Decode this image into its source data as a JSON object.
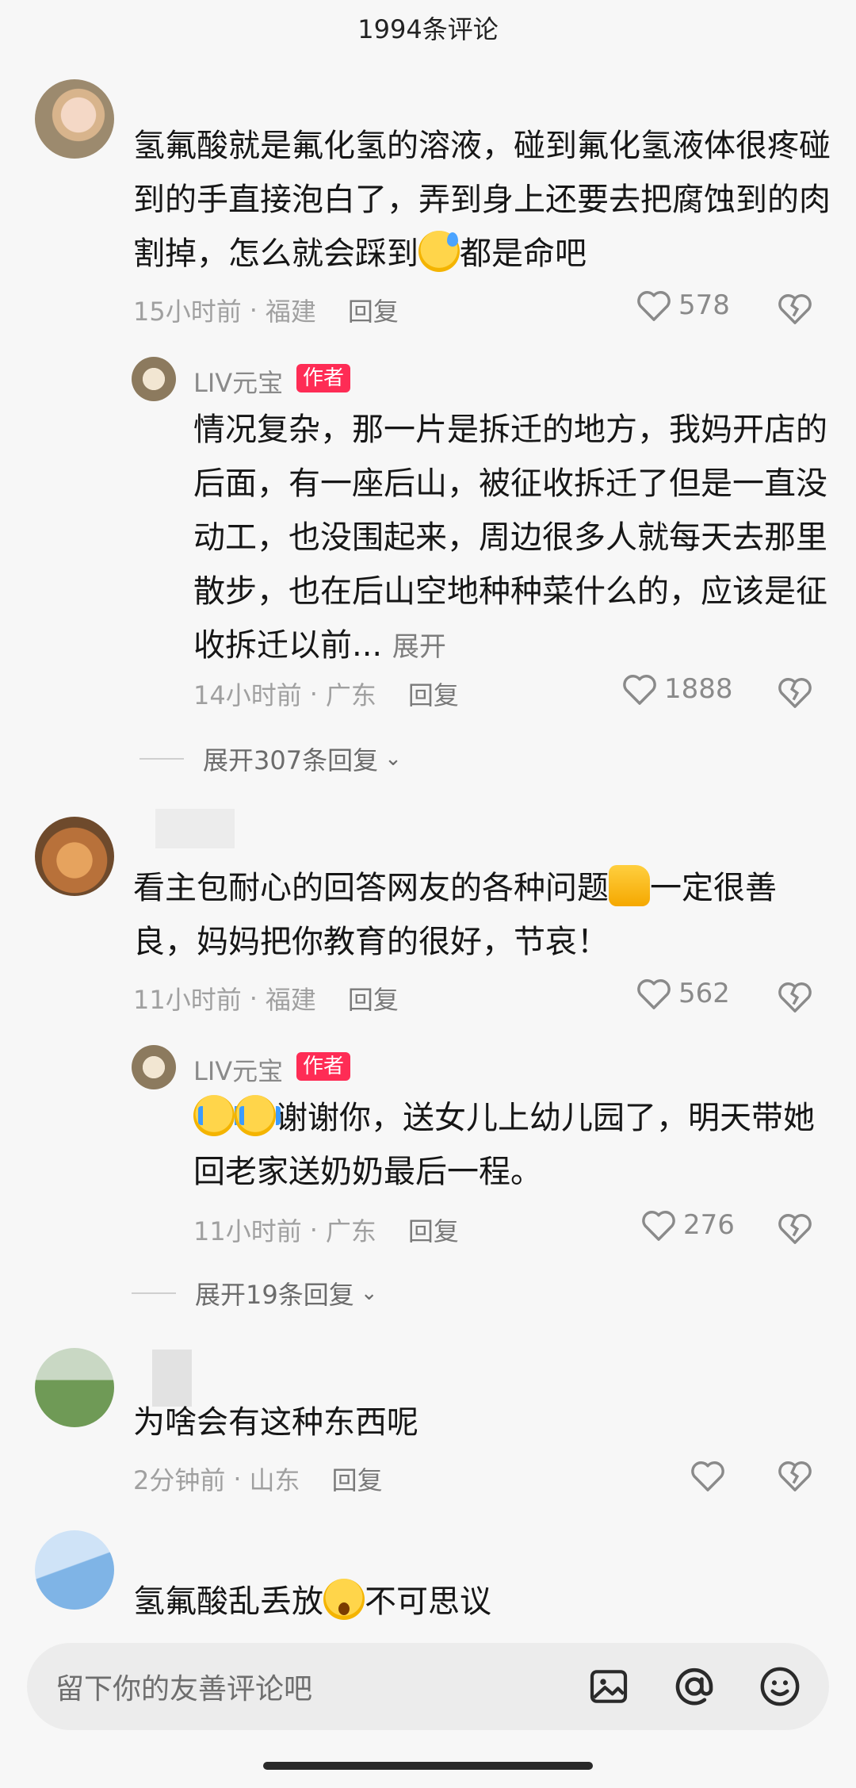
{
  "header": {
    "title": "1994条评论"
  },
  "comments": [
    {
      "text_parts": [
        "氢氟酸就是氟化氢的溶液，碰到氟化氢液体很疼碰到的手直接泡白了，弄到身上还要去把腐蚀到的肉割掉，怎么就会踩到",
        "都是命吧"
      ],
      "time": "15小时前",
      "location": "福建",
      "reply_label": "回复",
      "likes": "578",
      "reply": {
        "username": "LIV元宝",
        "badge": "作者",
        "text": "情况复杂，那一片是拆迁的地方，我妈开店的后面，有一座后山，被征收拆迁了但是一直没动工，也没围起来，周边很多人就每天去那里散步，也在后山空地种种菜什么的，应该是征收拆迁以前...",
        "more_label": "展开",
        "time": "14小时前",
        "location": "广东",
        "reply_label": "回复",
        "likes": "1888"
      },
      "expand_label": "展开307条回复"
    },
    {
      "text_parts": [
        "看主包耐心的回答网友的各种问题",
        "一定很善良，妈妈把你教育的很好，节哀！"
      ],
      "time": "11小时前",
      "location": "福建",
      "reply_label": "回复",
      "likes": "562",
      "reply": {
        "username": "LIV元宝",
        "badge": "作者",
        "text": "谢谢你，送女儿上幼儿园了，明天带她回老家送奶奶最后一程。",
        "time": "11小时前",
        "location": "广东",
        "reply_label": "回复",
        "likes": "276"
      },
      "expand_label": "展开19条回复"
    },
    {
      "text": "为啥会有这种东西呢",
      "time": "2分钟前",
      "location": "山东",
      "reply_label": "回复"
    },
    {
      "text_parts": [
        "氢氟酸乱丢放",
        "不可思议"
      ]
    }
  ],
  "input": {
    "placeholder": "留下你的友善评论吧"
  },
  "icons": {
    "like": "heart-icon",
    "dislike": "broken-heart-icon",
    "image": "image-icon",
    "mention": "at-icon",
    "emoji": "emoji-icon",
    "expand": "chevron-down-icon"
  },
  "colors": {
    "author_badge": "#fe2c55",
    "background": "#f7f7f7"
  }
}
